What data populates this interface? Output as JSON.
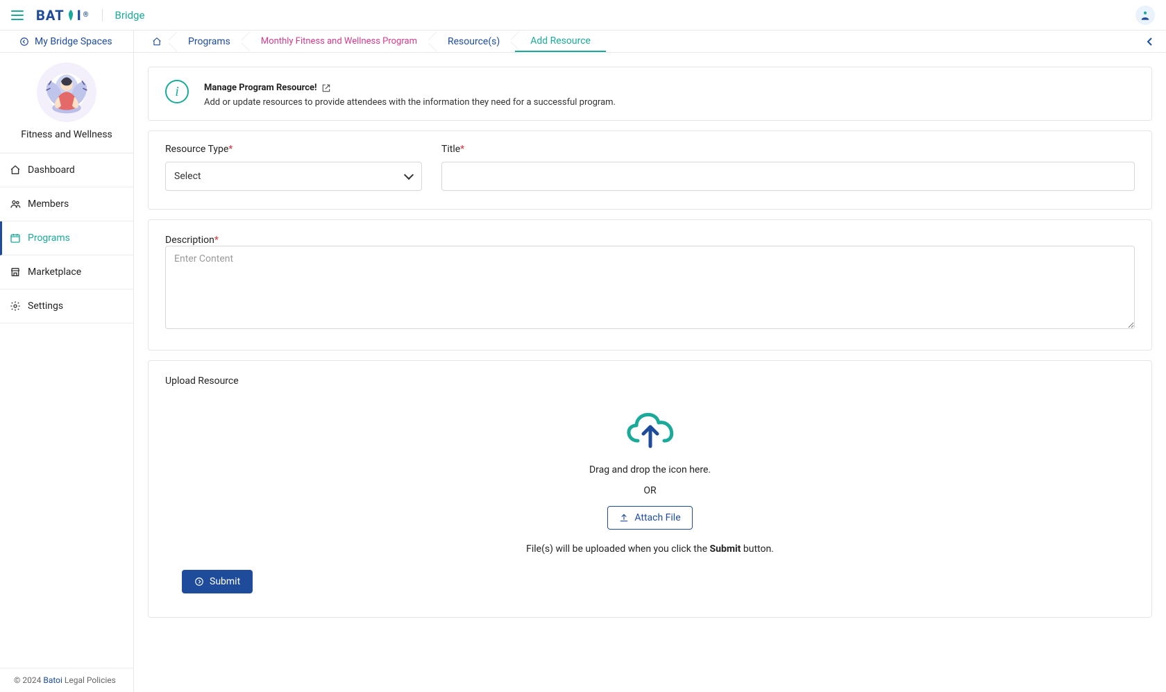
{
  "header": {
    "brand": "BAT",
    "brand_tail": "I",
    "brand_mark": "®",
    "app_name": "Bridge"
  },
  "secondbar": {
    "back_label": "My Bridge Spaces"
  },
  "breadcrumbs": {
    "items": [
      {
        "label": "Programs",
        "kind": "blue"
      },
      {
        "label": "Monthly Fitness and Wellness Program",
        "kind": "pink"
      },
      {
        "label": "Resource(s)",
        "kind": "blue"
      },
      {
        "label": "Add Resource",
        "kind": "green"
      }
    ]
  },
  "space": {
    "title": "Fitness and Wellness"
  },
  "sidebar": {
    "items": [
      {
        "label": "Dashboard",
        "icon": "home"
      },
      {
        "label": "Members",
        "icon": "members"
      },
      {
        "label": "Programs",
        "icon": "calendar",
        "active": true
      },
      {
        "label": "Marketplace",
        "icon": "store"
      },
      {
        "label": "Settings",
        "icon": "gear"
      }
    ]
  },
  "info": {
    "title": "Manage Program Resource!",
    "subtitle": "Add or update resources to provide attendees with the information they need for a successful program."
  },
  "form": {
    "resource_type_label": "Resource Type",
    "resource_type_placeholder": "Select",
    "title_label": "Title",
    "description_label": "Description",
    "description_placeholder": "Enter Content",
    "upload_label": "Upload Resource",
    "upload_dnd": "Drag and drop the icon here.",
    "upload_or": "OR",
    "attach_label": "Attach File",
    "upload_hint_pre": "File(s) will be uploaded when you click the ",
    "upload_hint_bold": "Submit",
    "upload_hint_post": " button.",
    "submit_label": "Submit"
  },
  "footer": {
    "copyright": "© 2024 ",
    "brand_link": "Batoi",
    "legal": " Legal Policies"
  }
}
